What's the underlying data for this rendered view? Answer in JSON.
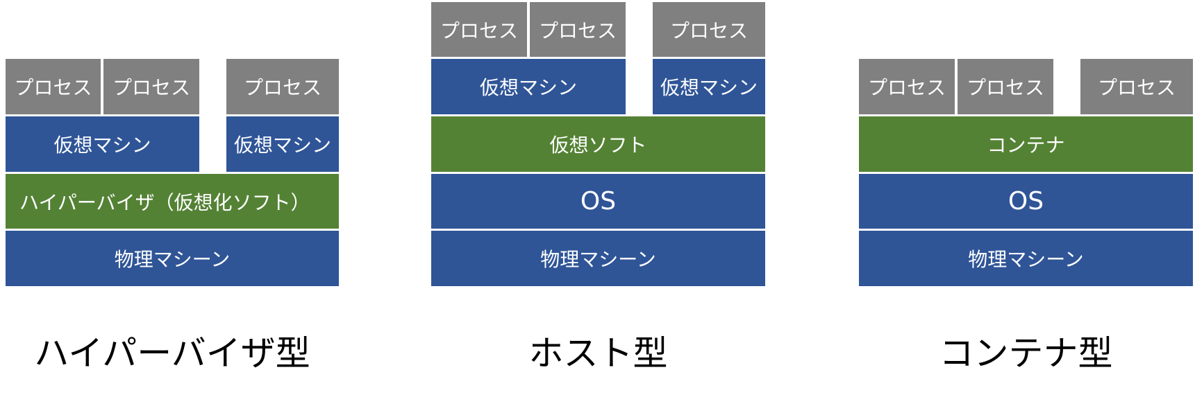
{
  "colors": {
    "process": "#808080",
    "machine": "#2f5597",
    "software": "#548235",
    "background": "#ffffff"
  },
  "hypervisor": {
    "processes": [
      "プロセス",
      "プロセス",
      "プロセス"
    ],
    "vms": [
      "仮想マシン",
      "仮想マシン"
    ],
    "hypervisor_label": "ハイパーバイザ（仮想化ソフト）",
    "physical": "物理マシーン",
    "caption": "ハイパーバイザ型"
  },
  "host": {
    "processes": [
      "プロセス",
      "プロセス",
      "プロセス"
    ],
    "vms": [
      "仮想マシン",
      "仮想マシン"
    ],
    "virtual_software": "仮想ソフト",
    "os": "OS",
    "physical": "物理マシーン",
    "caption": "ホスト型"
  },
  "container": {
    "processes": [
      "プロセス",
      "プロセス",
      "プロセス"
    ],
    "container_label": "コンテナ",
    "os": "OS",
    "physical": "物理マシーン",
    "caption": "コンテナ型"
  }
}
